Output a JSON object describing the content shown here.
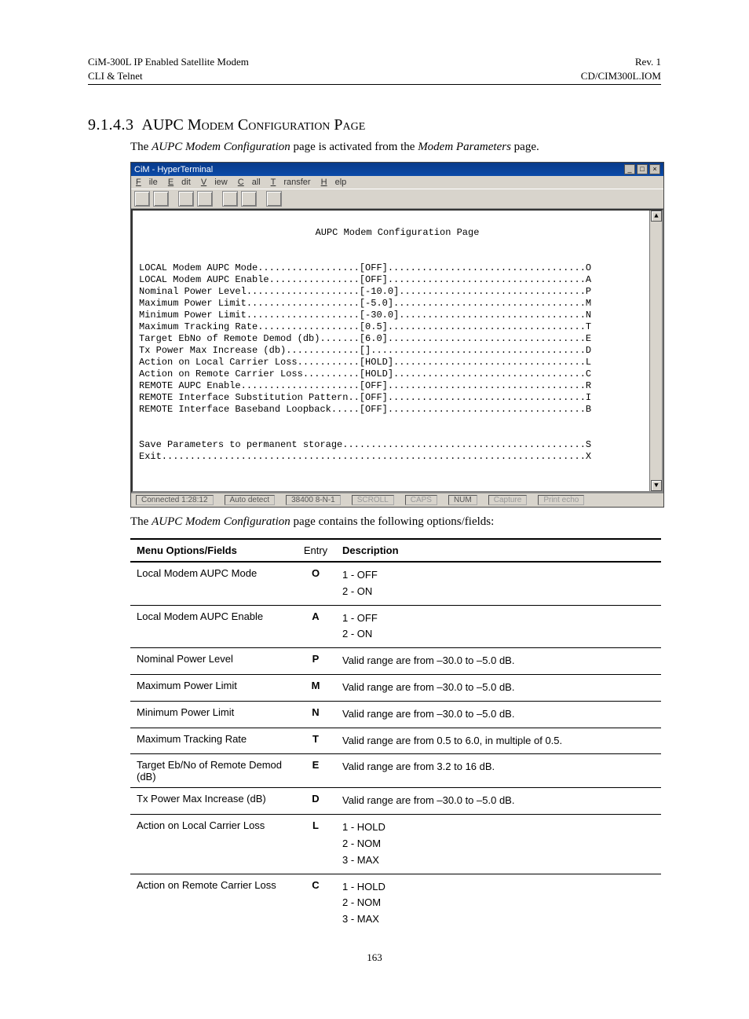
{
  "header": {
    "left_line1": "CiM-300L IP Enabled Satellite Modem",
    "left_line2": "CLI & Telnet",
    "right_line1": "Rev. 1",
    "right_line2": "CD/CIM300L.IOM"
  },
  "section": {
    "number": "9.1.4.3",
    "title": "AUPC Modem Configuration Page"
  },
  "intro": {
    "prefix": "The ",
    "em1": "AUPC Modem Configuration",
    "mid": " page is activated from the ",
    "em2": "Modem Parameters",
    "suffix": " page."
  },
  "terminal": {
    "window_title": "CiM - HyperTerminal",
    "menu": [
      "File",
      "Edit",
      "View",
      "Call",
      "Transfer",
      "Help"
    ],
    "page_title": "AUPC Modem Configuration Page",
    "rows": [
      {
        "label": "LOCAL Modem AUPC Mode",
        "value": "[OFF]",
        "key": "O"
      },
      {
        "label": "LOCAL Modem AUPC Enable",
        "value": "[OFF]",
        "key": "A"
      },
      {
        "label": "Nominal Power Level",
        "value": "[-10.0]",
        "key": "P"
      },
      {
        "label": "Maximum Power Limit",
        "value": "[-5.0]",
        "key": "M"
      },
      {
        "label": "Minimum Power Limit",
        "value": "[-30.0]",
        "key": "N"
      },
      {
        "label": "Maximum Tracking Rate",
        "value": "[0.5]",
        "key": "T"
      },
      {
        "label": "Target EbNo of Remote Demod (db)",
        "value": "[6.0]",
        "key": "E"
      },
      {
        "label": "Tx Power Max Increase (db)",
        "value": "[]",
        "key": "D"
      },
      {
        "label": "Action on Local Carrier Loss",
        "value": "[HOLD]",
        "key": "L"
      },
      {
        "label": "Action on Remote Carrier Loss",
        "value": "[HOLD]",
        "key": "C"
      },
      {
        "label": "REMOTE AUPC Enable",
        "value": "[OFF]",
        "key": "R"
      },
      {
        "label": "REMOTE Interface Substitution Pattern.",
        "value": "[OFF]",
        "key": "I"
      },
      {
        "label": "REMOTE Interface Baseband Loopback",
        "value": "[OFF]",
        "key": "B"
      }
    ],
    "footer_rows": [
      {
        "label": "Save Parameters to permanent storage",
        "key": "S"
      },
      {
        "label": "Exit",
        "key": "X"
      }
    ],
    "status": {
      "connected": "Connected 1:28:12",
      "detect": "Auto detect",
      "baud": "38400 8-N-1",
      "flags": [
        "SCROLL",
        "CAPS",
        "NUM",
        "Capture",
        "Print echo"
      ]
    }
  },
  "note": {
    "prefix": "The ",
    "em": "AUPC Modem Configuration",
    "suffix": " page contains the following options/fields:"
  },
  "table": {
    "headers": [
      "Menu Options/Fields",
      "Entry",
      "Description"
    ],
    "rows": [
      {
        "field": "Local Modem AUPC Mode",
        "entry": "O",
        "desc": [
          "1 - OFF",
          "2 - ON"
        ]
      },
      {
        "field": "Local Modem AUPC Enable",
        "entry": "A",
        "desc": [
          "1 - OFF",
          "2 - ON"
        ]
      },
      {
        "field": "Nominal Power Level",
        "entry": "P",
        "desc": [
          "Valid range are from –30.0 to –5.0 dB."
        ]
      },
      {
        "field": "Maximum Power Limit",
        "entry": "M",
        "desc": [
          "Valid range are from –30.0 to –5.0 dB."
        ]
      },
      {
        "field": "Minimum Power Limit",
        "entry": "N",
        "desc": [
          "Valid range are from –30.0 to –5.0 dB."
        ]
      },
      {
        "field": "Maximum Tracking Rate",
        "entry": "T",
        "desc": [
          "Valid range are from 0.5 to 6.0, in multiple of 0.5."
        ]
      },
      {
        "field": "Target Eb/No of Remote Demod (dB)",
        "entry": "E",
        "desc": [
          "Valid range are from 3.2 to 16 dB."
        ]
      },
      {
        "field": "Tx Power Max Increase (dB)",
        "entry": "D",
        "desc": [
          "Valid range are from –30.0 to –5.0 dB."
        ]
      },
      {
        "field": "Action on Local Carrier Loss",
        "entry": "L",
        "desc": [
          "1 - HOLD",
          "2 - NOM",
          "3 - MAX"
        ]
      },
      {
        "field": "Action on Remote Carrier Loss",
        "entry": "C",
        "desc": [
          "1 - HOLD",
          "2 - NOM",
          "3 - MAX"
        ]
      }
    ]
  },
  "page_number": "163"
}
